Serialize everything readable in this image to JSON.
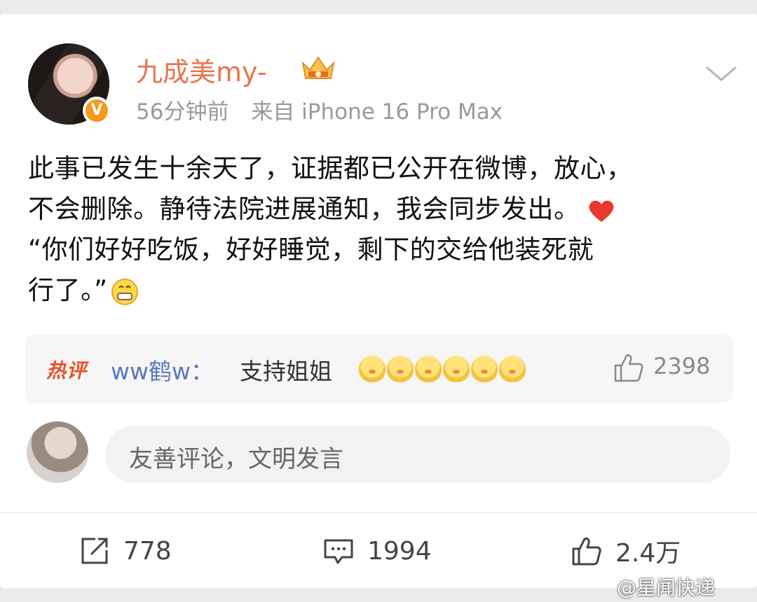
{
  "post": {
    "username": "九成美my-",
    "time": "56分钟前",
    "source": "来自 iPhone 16 Pro Max",
    "lines": [
      "此事已发生十余天了，证据都已公开在微博，放心，",
      "不会删除。静待法院进展通知，我会同步发出。",
      "“你们好好吃饭，好好睡觉，剩下的交给他装死就",
      "行了。”"
    ],
    "emoji": [
      "heart-emoji",
      "grin-emoji"
    ]
  },
  "hot_comment": {
    "tag": "热评",
    "user": "ww鹤w",
    "separator": "：",
    "text": "支持姐姐",
    "likes": "2398"
  },
  "comment_input": {
    "placeholder": "友善评论，文明发言"
  },
  "actions": {
    "repost": "778",
    "comment": "1994",
    "like": "2.4万"
  },
  "watermark": "@星闻快递",
  "colors": {
    "username": "#eb7350",
    "link": "#5a79b8",
    "hot_tag": "#e8502d"
  }
}
